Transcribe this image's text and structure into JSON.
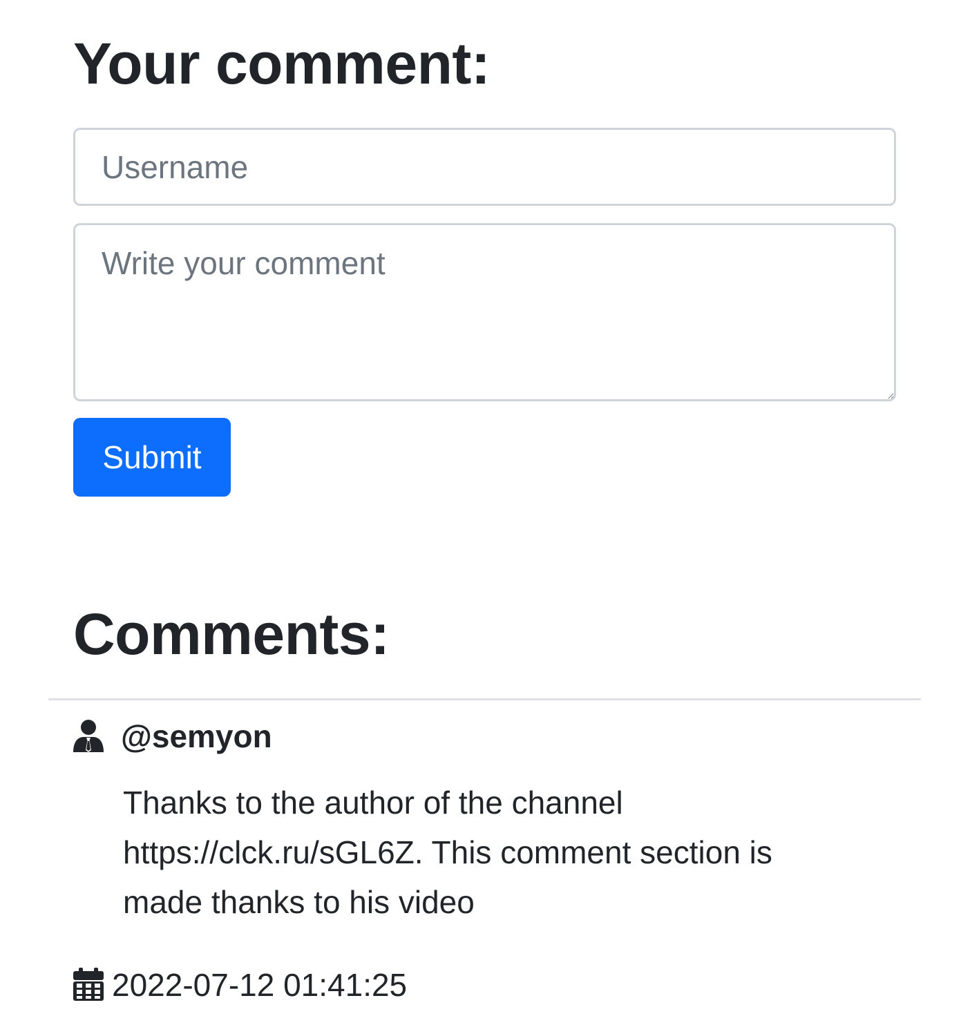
{
  "form": {
    "title": "Your comment:",
    "username_placeholder": "Username",
    "comment_placeholder": "Write your comment",
    "submit_label": "Submit",
    "submit_color": "#0d6efd"
  },
  "comments": {
    "title": "Comments:",
    "items": [
      {
        "username": "@semyon",
        "text": "Thanks to the author of the channel https://clck.ru/sGL6Z. This comment section is made thanks to his video",
        "date": "2022-07-12 01:41:25",
        "user_icon": "user-tie-icon",
        "date_icon": "calendar-icon"
      }
    ]
  }
}
